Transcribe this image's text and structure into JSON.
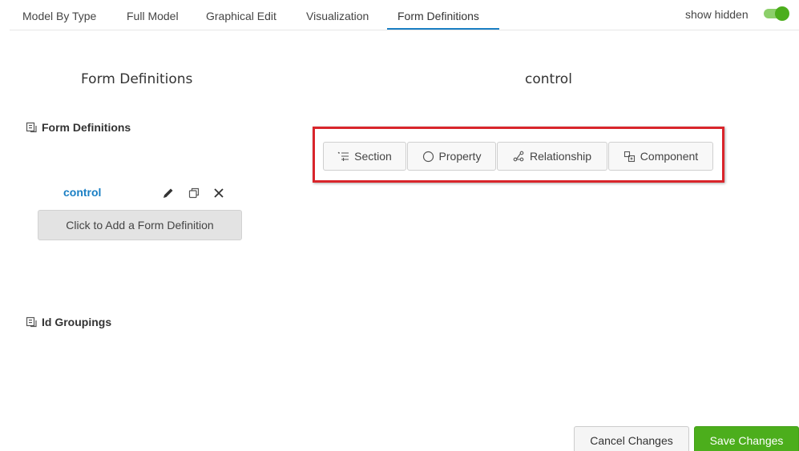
{
  "tabs": [
    {
      "label": "Model By Type"
    },
    {
      "label": "Full Model"
    },
    {
      "label": "Graphical Edit"
    },
    {
      "label": "Visualization"
    },
    {
      "label": "Form Definitions",
      "active": true
    }
  ],
  "show_hidden": {
    "label": "show hidden",
    "on": true
  },
  "left_panel": {
    "title": "Form Definitions",
    "form_definitions_heading": "Form Definitions",
    "items": [
      {
        "name": "control"
      }
    ],
    "add_button": "Click to Add a Form Definition",
    "id_groupings_heading": "Id Groupings"
  },
  "right_panel": {
    "title": "control",
    "buttons": [
      {
        "label": "Section",
        "icon": "section-icon"
      },
      {
        "label": "Property",
        "icon": "property-icon"
      },
      {
        "label": "Relationship",
        "icon": "relationship-icon"
      },
      {
        "label": "Component",
        "icon": "component-icon"
      }
    ]
  },
  "footer": {
    "cancel": "Cancel Changes",
    "save": "Save Changes"
  },
  "colors": {
    "accent": "#1a7fc4",
    "save": "#4cae1c",
    "highlight": "#d9252b"
  }
}
